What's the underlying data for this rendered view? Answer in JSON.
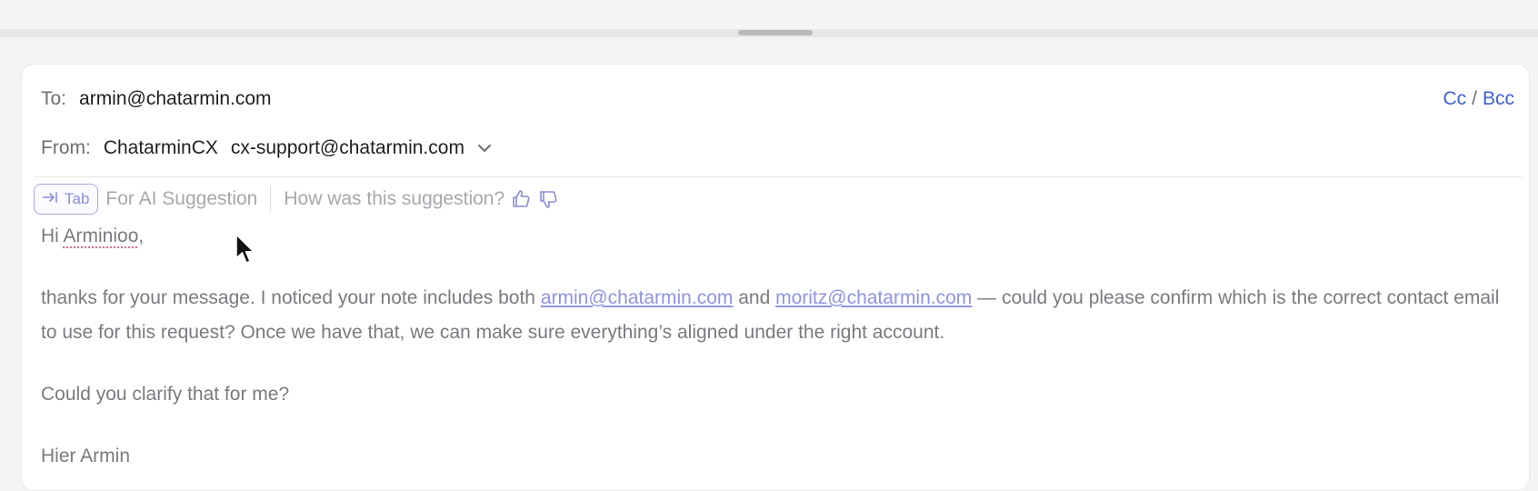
{
  "header": {
    "to_label": "To:",
    "to_value": "armin@chatarmin.com",
    "cc_label": "Cc",
    "separator": "/",
    "bcc_label": "Bcc",
    "from_label": "From:",
    "from_name": "ChatarminCX",
    "from_email": "cx-support@chatarmin.com",
    "from_dropdown_icon": "chevron-down-icon"
  },
  "suggestion": {
    "tab_key_label": "Tab",
    "tab_icon": "tab-arrow-icon",
    "hint": "For AI Suggestion",
    "feedback_prompt": "How was this suggestion?",
    "thumbs_up_icon": "thumbs-up-icon",
    "thumbs_down_icon": "thumbs-down-icon"
  },
  "body": {
    "greeting_prefix": "Hi ",
    "greeting_name": "Arminioo",
    "greeting_suffix": ",",
    "p1_part1": "thanks for your message. I noticed your note includes both ",
    "p1_link1": "armin@chatarmin.com",
    "p1_part2": " and ",
    "p1_link2": "moritz@chatarmin.com",
    "p1_part3": " — could you please confirm which is the correct contact email to use for this request? Once we have that, we can make sure everything’s aligned under the right account.",
    "p2": "Could you clarify that for me?",
    "signoff": "Hier Armin"
  },
  "colors": {
    "link": "#3d5fd6",
    "suggestion_accent": "#8a8cd8",
    "suggested_text": "#7a7a80"
  }
}
